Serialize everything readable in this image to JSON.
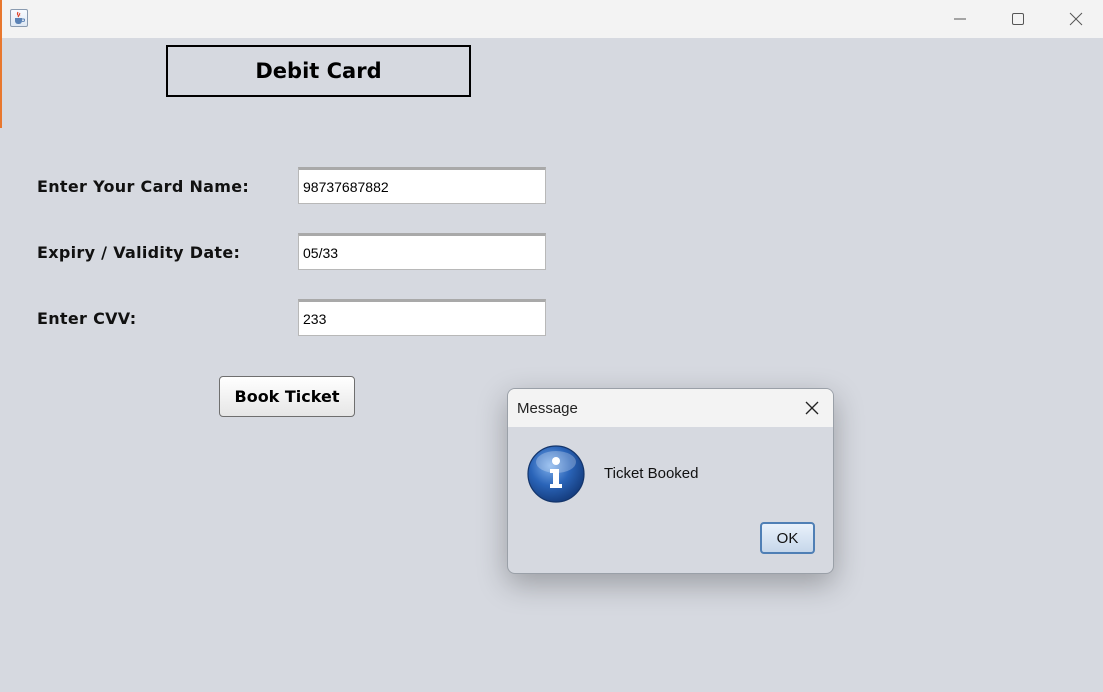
{
  "window": {
    "title_icon": "java-cup-icon",
    "controls": [
      "minimize-icon",
      "maximize-icon",
      "close-icon"
    ]
  },
  "form": {
    "heading": "Debit Card",
    "card_name_label": "Enter Your Card Name:",
    "card_name_value": "98737687882",
    "expiry_label": "Expiry / Validity Date:",
    "expiry_value": "05/33",
    "cvv_label": "Enter CVV:",
    "cvv_value": "233",
    "book_button": "Book Ticket"
  },
  "dialog": {
    "title": "Message",
    "icon": "info-icon",
    "message": "Ticket Booked",
    "ok_button": "OK"
  },
  "colors": {
    "window_background": "#d6d9e0",
    "titlebar": "#f3f3f3",
    "info_icon_blue": "#2a64b8"
  }
}
